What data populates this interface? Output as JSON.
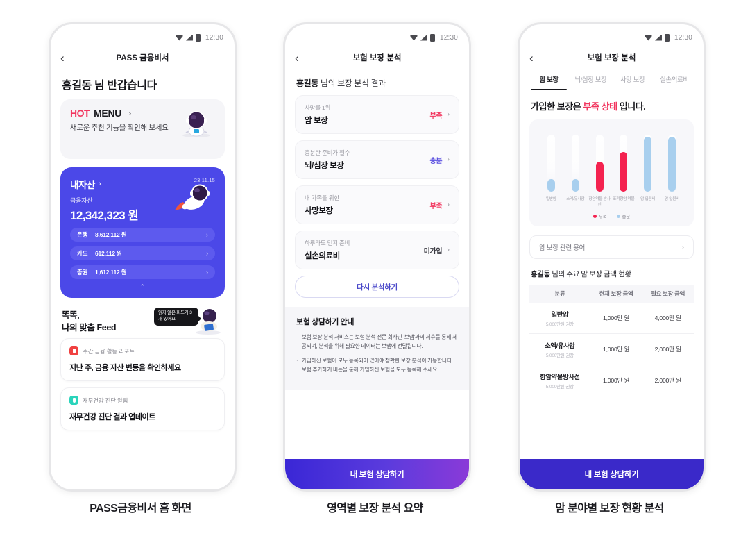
{
  "status_bar": {
    "time": "12:30"
  },
  "captions": {
    "phone1": "PASS금융비서 홈 화면",
    "phone2": "영역별 보장 분석 요약",
    "phone3": "암 분야별 보장 현황 분석"
  },
  "phone1": {
    "nav_title": "PASS 금융비서",
    "greeting": "홍길동 님 반갑습니다",
    "hot_menu": {
      "hot": "HOT",
      "menu": "MENU",
      "chevron": "›",
      "subtitle": "새로운 추천 기능을 확인해 보세요"
    },
    "asset": {
      "title": "내자산",
      "chevron": "›",
      "date": "23.11.15",
      "label": "금융자산",
      "amount": "12,342,323 원",
      "rows": [
        {
          "name": "은행",
          "value": "8,612,112 원"
        },
        {
          "name": "카드",
          "value": "612,112 원"
        },
        {
          "name": "증권",
          "value": "1,612,112 원"
        }
      ],
      "collapse": "⌃"
    },
    "feed": {
      "title_line1": "똑똑,",
      "title_line2": "나의 맞춤 Feed",
      "bubble": "읽지 않은 피드가 3개 있어요",
      "items": [
        {
          "category": "주간 금융 활동 리포트",
          "text": "지난 주, 금융 자산 변동을 확인하세요",
          "icon": "report-icon",
          "color": "#f04141"
        },
        {
          "category": "재무건강 진단 알림",
          "text": "재무건강 진단 결과 업데이트",
          "icon": "health-icon",
          "color": "#2ad4bb"
        }
      ]
    }
  },
  "phone2": {
    "nav_title": "보험 보장 분석",
    "head_bold": "홍길동",
    "head_rest": " 님의 보장 분석 결과",
    "coverages": [
      {
        "sub": "사망률 1위",
        "name": "암 보장",
        "status": "부족",
        "status_color": "#f2365f"
      },
      {
        "sub": "충분한 준비가 필수",
        "name": "뇌/심장 보장",
        "status": "충분",
        "status_color": "#5a4fe0"
      },
      {
        "sub": "내 가족을 위한",
        "name": "사망보장",
        "status": "부족",
        "status_color": "#f2365f"
      },
      {
        "sub": "하루라도 먼저 준비",
        "name": "실손의료비",
        "status": "미가입",
        "status_color": "#3a3a42"
      }
    ],
    "reanalyze": "다시 분석하기",
    "notice": {
      "title": "보험 상담하기 안내",
      "items": [
        "보험 보장 분석 서비스는 보험 분석 전문 회사인 '보맵'과의 제휴를 통해 제공되며, 분석을 위해 필요한 데이터는 보맵에 전달됩니다.",
        "가입하신 보험이 모두 등록되어 있어야 정확한 보장 분석이 가능합니다. 보험 추가하기 버튼을 통해 가입하신 보험을 모두 등록해 주세요."
      ]
    },
    "cta": "내 보험 상담하기"
  },
  "phone3": {
    "nav_title": "보험 보장 분석",
    "tabs": [
      {
        "label": "암 보장",
        "active": true
      },
      {
        "label": "뇌/심장 보장",
        "active": false
      },
      {
        "label": "사망 보장",
        "active": false
      },
      {
        "label": "실손의료비",
        "active": false
      }
    ],
    "headline_pre": "가입한 보장은 ",
    "headline_accent": "부족 상태",
    "headline_post": " 입니다.",
    "term_link": "암 보장 관련 용어",
    "term_chevron": "›",
    "table_title_bold": "홍길동",
    "table_title_rest": " 님의 주요 암 보장 금액 현황",
    "table": {
      "headers": [
        "분류",
        "현재 보장 금액",
        "필요 보장 금액"
      ],
      "rows": [
        {
          "name": "일반암",
          "sub": "5,000만원 권장",
          "current": "1,000만 원",
          "needed": "4,000만 원"
        },
        {
          "name": "소액/유사암",
          "sub": "5,000만원 권장",
          "current": "1,000만 원",
          "needed": "2,000만 원"
        },
        {
          "name": "항암약물방사선",
          "sub": "5,000만원 권장",
          "current": "1,000만 원",
          "needed": "2,000만 원"
        }
      ]
    },
    "cta": "내 보험 상담하기"
  },
  "chart_data": {
    "type": "bar",
    "title": "암 분야별 보장 현황",
    "categories": [
      "일반암",
      "소액/유사암",
      "항암약물 방사선",
      "표적항암 약물",
      "암 입원비",
      "암 입원비"
    ],
    "values": [
      22,
      22,
      52,
      70,
      96,
      96
    ],
    "fill_colors": [
      "#a8cfee",
      "#a8cfee",
      "#f4224f",
      "#f4224f",
      "#a8cfee",
      "#a8cfee"
    ],
    "statuses": [
      "충분",
      "충분",
      "부족",
      "부족",
      "충분",
      "충분"
    ],
    "track_color": "#ffffff",
    "ylim": [
      0,
      100
    ],
    "ylabel": "",
    "xlabel": "",
    "grid": false,
    "legend_position": "bottom",
    "legend": [
      {
        "label": "부족",
        "color": "#f4224f"
      },
      {
        "label": "충분",
        "color": "#a8cfee"
      }
    ]
  }
}
